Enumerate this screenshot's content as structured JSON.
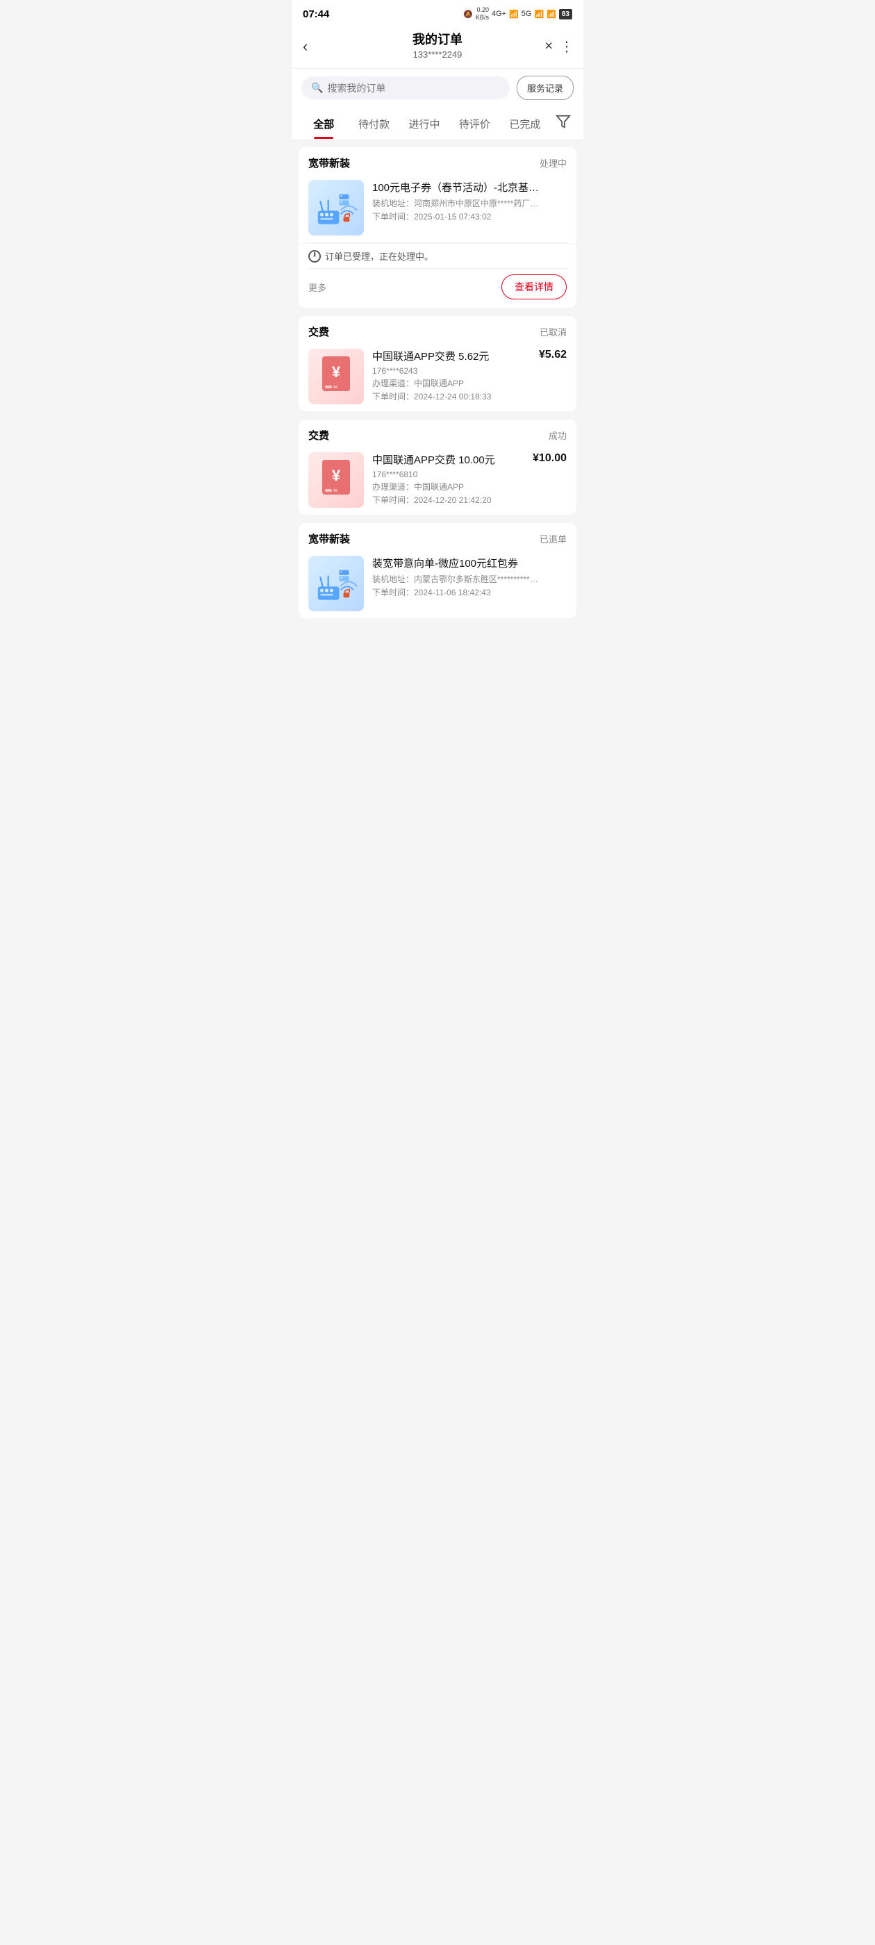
{
  "statusBar": {
    "time": "07:44",
    "networkSpeed": "0.20\nKB/s",
    "networkType1": "4G+",
    "networkType2": "5G",
    "battery": "83"
  },
  "header": {
    "title": "我的订单",
    "subtitle": "133****2249",
    "backLabel": "‹",
    "closeLabel": "×",
    "moreLabel": "⋮"
  },
  "search": {
    "placeholder": "搜索我的订单",
    "serviceRecordLabel": "服务记录"
  },
  "tabs": [
    {
      "label": "全部",
      "active": true
    },
    {
      "label": "待付款",
      "active": false
    },
    {
      "label": "进行中",
      "active": false
    },
    {
      "label": "待评价",
      "active": false
    },
    {
      "label": "已完成",
      "active": false
    }
  ],
  "orders": [
    {
      "type": "宽带新装",
      "status": "处理中",
      "statusClass": "processing",
      "thumbType": "broadband",
      "name": "100元电子券（春节活动）-北京基…",
      "address": "装机地址：河南郑州市中原区中原*****药厂…",
      "orderTime": "下单时间：2025-01-15 07:43:02",
      "statusMessage": "订单已受理，正在处理中。",
      "price": null,
      "moreLabel": "更多",
      "detailBtnLabel": "查看详情",
      "showDetailBtn": true
    },
    {
      "type": "交费",
      "status": "已取消",
      "statusClass": "cancelled",
      "thumbType": "payment",
      "name": "中国联通APP交费 5.62元",
      "phone": "176****6243",
      "channel": "办理渠道：中国联通APP",
      "orderTime": "下单时间：2024-12-24 00:18:33",
      "statusMessage": null,
      "price": "¥5.62",
      "moreLabel": null,
      "detailBtnLabel": null,
      "showDetailBtn": false
    },
    {
      "type": "交费",
      "status": "成功",
      "statusClass": "success",
      "thumbType": "payment",
      "name": "中国联通APP交费 10.00元",
      "phone": "176****6810",
      "channel": "办理渠道：中国联通APP",
      "orderTime": "下单时间：2024-12-20 21:42:20",
      "statusMessage": null,
      "price": "¥10.00",
      "moreLabel": null,
      "detailBtnLabel": null,
      "showDetailBtn": false
    },
    {
      "type": "宽带新装",
      "status": "已退单",
      "statusClass": "refunded",
      "thumbType": "broadband",
      "name": "装宽带意向单-微应100元红包券",
      "address": "装机地址：内蒙古鄂尔多斯东胜区**********…",
      "orderTime": "下单时间：2024-11-06 18:42:43",
      "statusMessage": null,
      "price": null,
      "moreLabel": null,
      "detailBtnLabel": null,
      "showDetailBtn": false
    }
  ]
}
